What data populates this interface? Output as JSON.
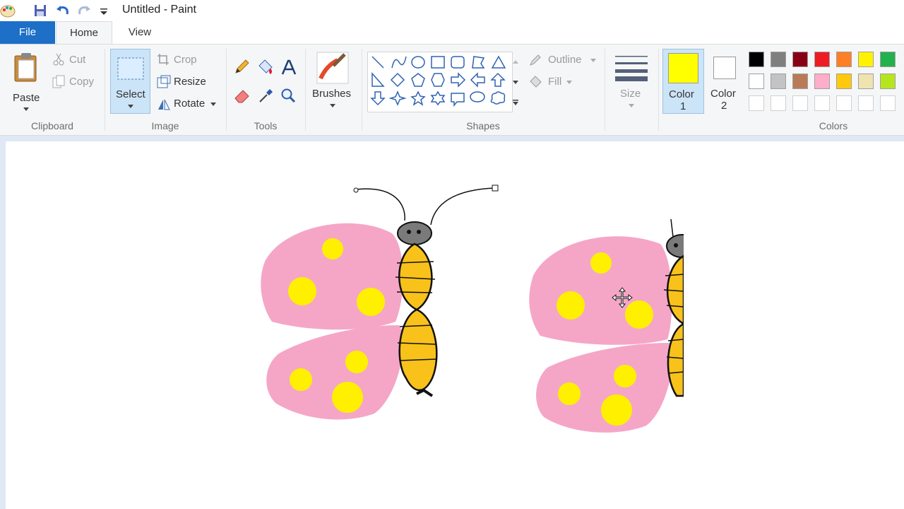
{
  "window": {
    "title": "Untitled - Paint"
  },
  "menu": {
    "file": "File",
    "home": "Home",
    "view": "View"
  },
  "clipboard": {
    "paste": "Paste",
    "cut": "Cut",
    "copy": "Copy",
    "label": "Clipboard"
  },
  "image": {
    "select": "Select",
    "crop": "Crop",
    "resize": "Resize",
    "rotate": "Rotate",
    "label": "Image"
  },
  "tools": {
    "label": "Tools"
  },
  "brushes": {
    "label": "Brushes"
  },
  "shapes": {
    "outline": "Outline",
    "fill": "Fill",
    "label": "Shapes"
  },
  "size": {
    "label": "Size"
  },
  "colors": {
    "color1": "Color",
    "color1_num": "1",
    "color2": "Color",
    "color2_num": "2",
    "label": "Colors",
    "color1_value": "#ffff00",
    "color2_value": "#ffffff",
    "palette_row1": [
      "#000000",
      "#7f7f7f",
      "#880015",
      "#ed1c24",
      "#ff7f27",
      "#fff200",
      "#22b14c",
      "#00a2e8"
    ],
    "palette_row2": [
      "#ffffff",
      "#c3c3c3",
      "#b97a57",
      "#ffaec9",
      "#ffc90e",
      "#efe4b0",
      "#b5e61d",
      "#99d9ea"
    ]
  }
}
